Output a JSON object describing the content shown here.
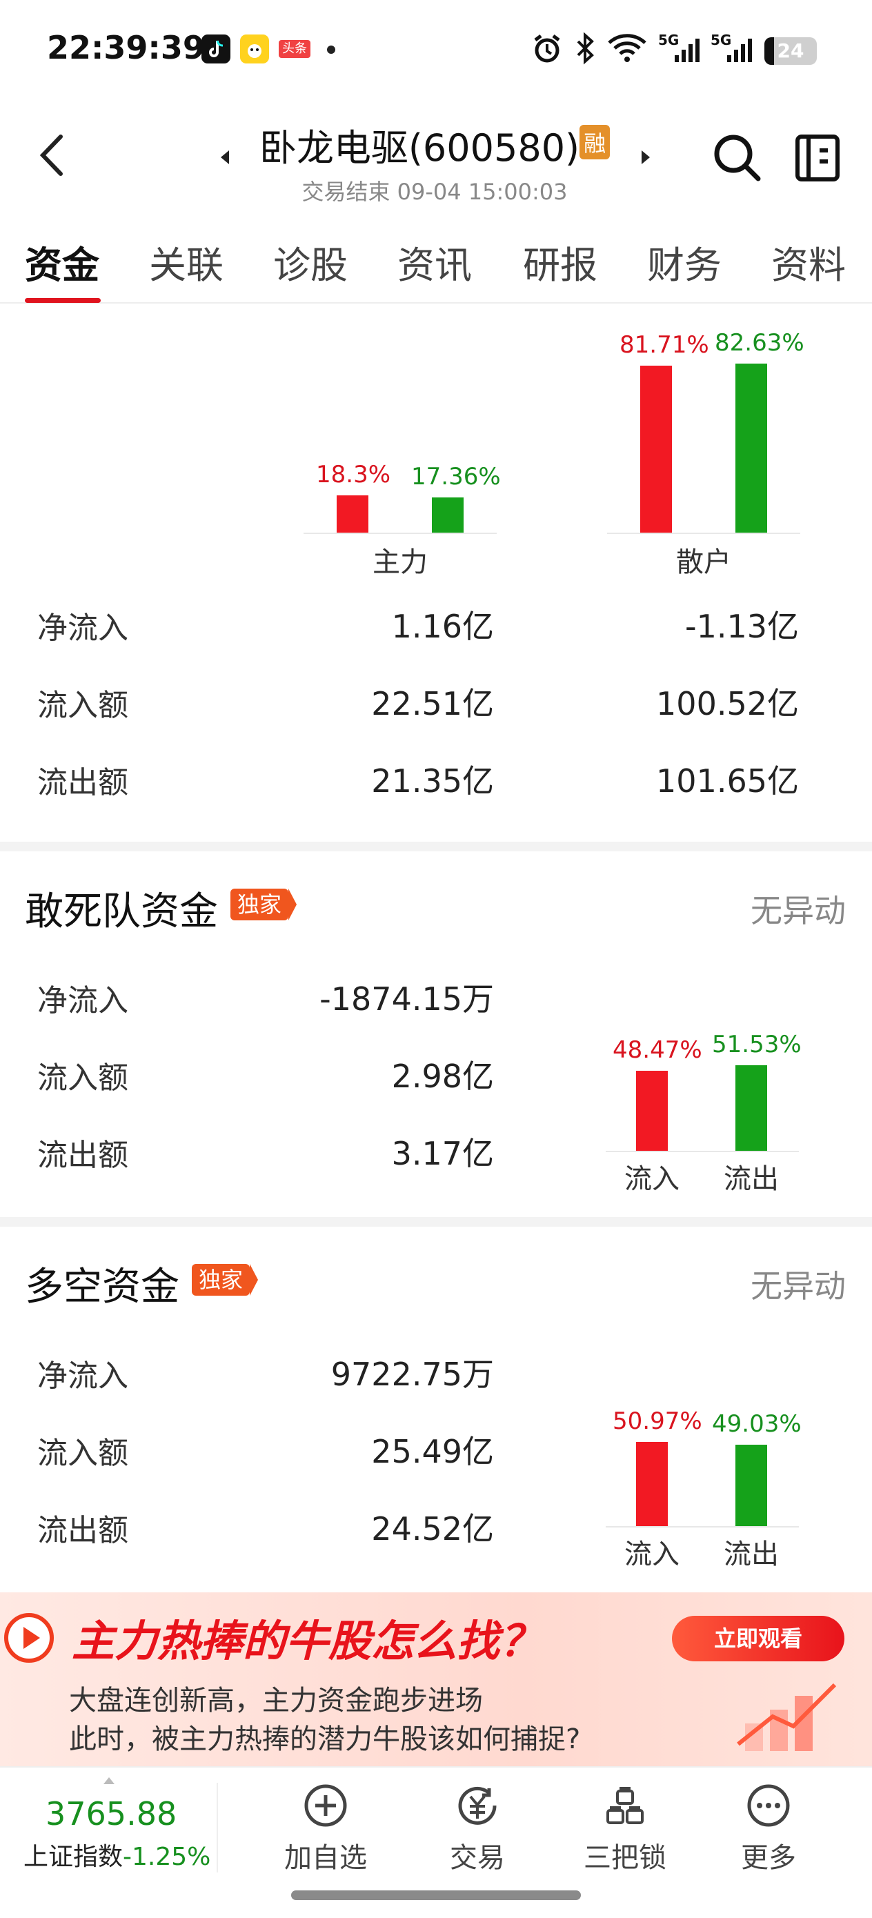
{
  "status_bar": {
    "time": "22:39:39",
    "apps": [
      "tiktok-icon",
      "chick-app-icon",
      "toutiao-icon"
    ],
    "toutiao_text": "头条",
    "network_1": "5G",
    "network_2": "5G",
    "battery": "24"
  },
  "header": {
    "title": "卧龙电驱(600580)",
    "badge": "融",
    "subtitle": "交易结束 09-04 15:00:03"
  },
  "tabs": [
    "资金",
    "关联",
    "诊股",
    "资讯",
    "研报",
    "财务",
    "资料"
  ],
  "main_chart": {
    "chart_data": [
      {
        "type": "bar",
        "categories": [
          "主力",
          "散户"
        ],
        "series": [
          {
            "values": [
              18.3,
              81.71
            ]
          },
          {
            "values": [
              17.36,
              82.63
            ]
          }
        ],
        "labels": [
          [
            "18.3%",
            "17.36%"
          ],
          [
            "81.71%",
            "82.63%"
          ]
        ],
        "colors": [
          "#f21923",
          "#15a21a"
        ]
      }
    ]
  },
  "capital_table": {
    "rows": [
      {
        "label": "净流入",
        "zhuli": "1.16亿",
        "sanhu": "-1.13亿"
      },
      {
        "label": "流入额",
        "zhuli": "22.51亿",
        "sanhu": "100.52亿"
      },
      {
        "label": "流出额",
        "zhuli": "21.35亿",
        "sanhu": "101.65亿"
      }
    ]
  },
  "dare_squad": {
    "title": "敢死队资金",
    "badge": "独家",
    "status": "无异动",
    "rows": [
      {
        "label": "净流入",
        "value": "-1874.15万"
      },
      {
        "label": "流入额",
        "value": "2.98亿"
      },
      {
        "label": "流出额",
        "value": "3.17亿"
      }
    ],
    "chart_data": {
      "type": "bar",
      "categories": [
        "流入",
        "流出"
      ],
      "values": [
        48.47,
        51.53
      ],
      "labels": [
        "48.47%",
        "51.53%"
      ]
    }
  },
  "long_short": {
    "title": "多空资金",
    "badge": "独家",
    "status": "无异动",
    "rows": [
      {
        "label": "净流入",
        "value": "9722.75万"
      },
      {
        "label": "流入额",
        "value": "25.49亿"
      },
      {
        "label": "流出额",
        "value": "24.52亿"
      }
    ],
    "chart_data": {
      "type": "bar",
      "categories": [
        "流入",
        "流出"
      ],
      "values": [
        50.97,
        49.03
      ],
      "labels": [
        "50.97%",
        "49.03%"
      ]
    }
  },
  "banner": {
    "headline": "主力热捧的牛股怎么找？",
    "line1": "大盘连创新高，主力资金跑步进场",
    "line2": "此时，被主力热捧的潜力牛股该如何捕捉?",
    "button": "立即观看"
  },
  "bottom_nav": {
    "index_value": "3765.88",
    "index_name": "上证指数",
    "index_change": "-1.25%",
    "items": [
      "加自选",
      "交易",
      "三把锁",
      "更多"
    ]
  }
}
